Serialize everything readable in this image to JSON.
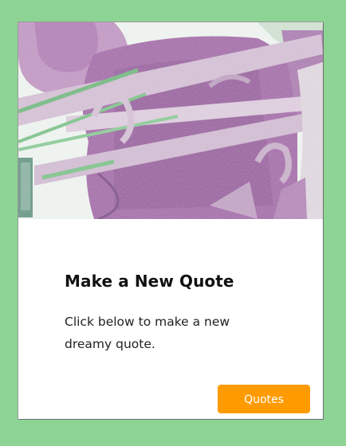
{
  "card": {
    "image_alt": "purple pliers illustration",
    "title": "Make a New Quote",
    "description": "Click below to make a new dreamy quote.",
    "button_label": "Quotes"
  },
  "colors": {
    "page_background": "#8dd494",
    "card_background": "#ffffff",
    "button": "#ff9b00",
    "illustration_primary": "#a866b0"
  }
}
